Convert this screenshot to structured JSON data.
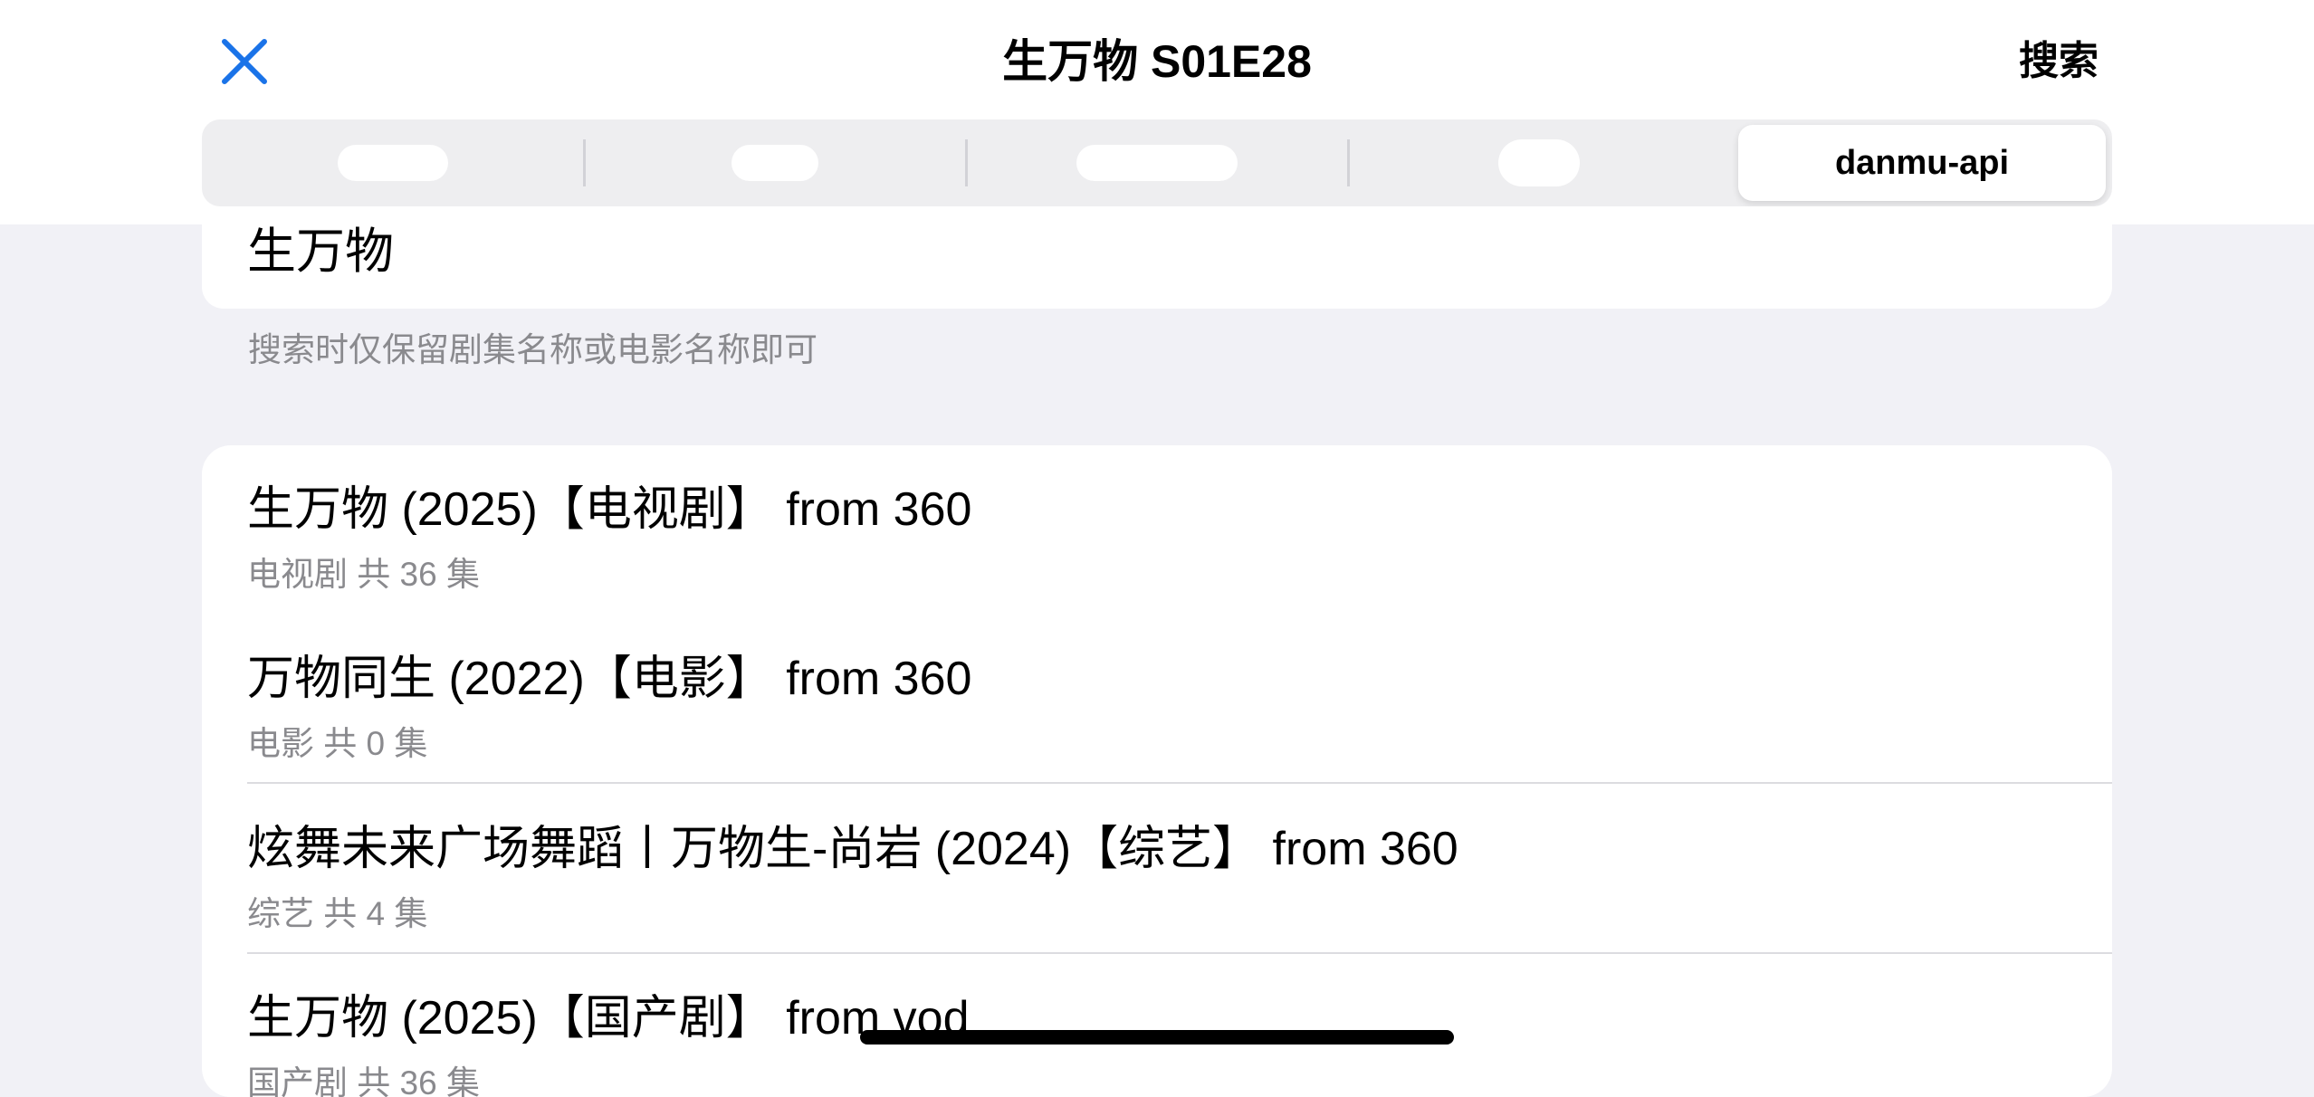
{
  "header": {
    "title": "生万物 S01E28",
    "search_label": "搜索"
  },
  "segments": {
    "selected_label": "danmu-api"
  },
  "query": {
    "value": "生万物",
    "hint": "搜索时仅保留剧集名称或电影名称即可"
  },
  "results": [
    {
      "title": "生万物 (2025)【电视剧】 from 360",
      "subtitle": "电视剧 共 36 集"
    },
    {
      "title": "万物同生 (2022)【电影】 from 360",
      "subtitle": "电影 共 0 集"
    },
    {
      "title": "炫舞未来广场舞蹈丨万物生-尚岩 (2024)【综艺】 from 360",
      "subtitle": "综艺 共 4 集"
    },
    {
      "title": "生万物 (2025)【国产剧】 from vod",
      "subtitle": "国产剧 共 36 集"
    }
  ],
  "colors": {
    "accent": "#1a73e8",
    "background": "#f1f1f6",
    "secondary_text": "#8a8a8e"
  }
}
